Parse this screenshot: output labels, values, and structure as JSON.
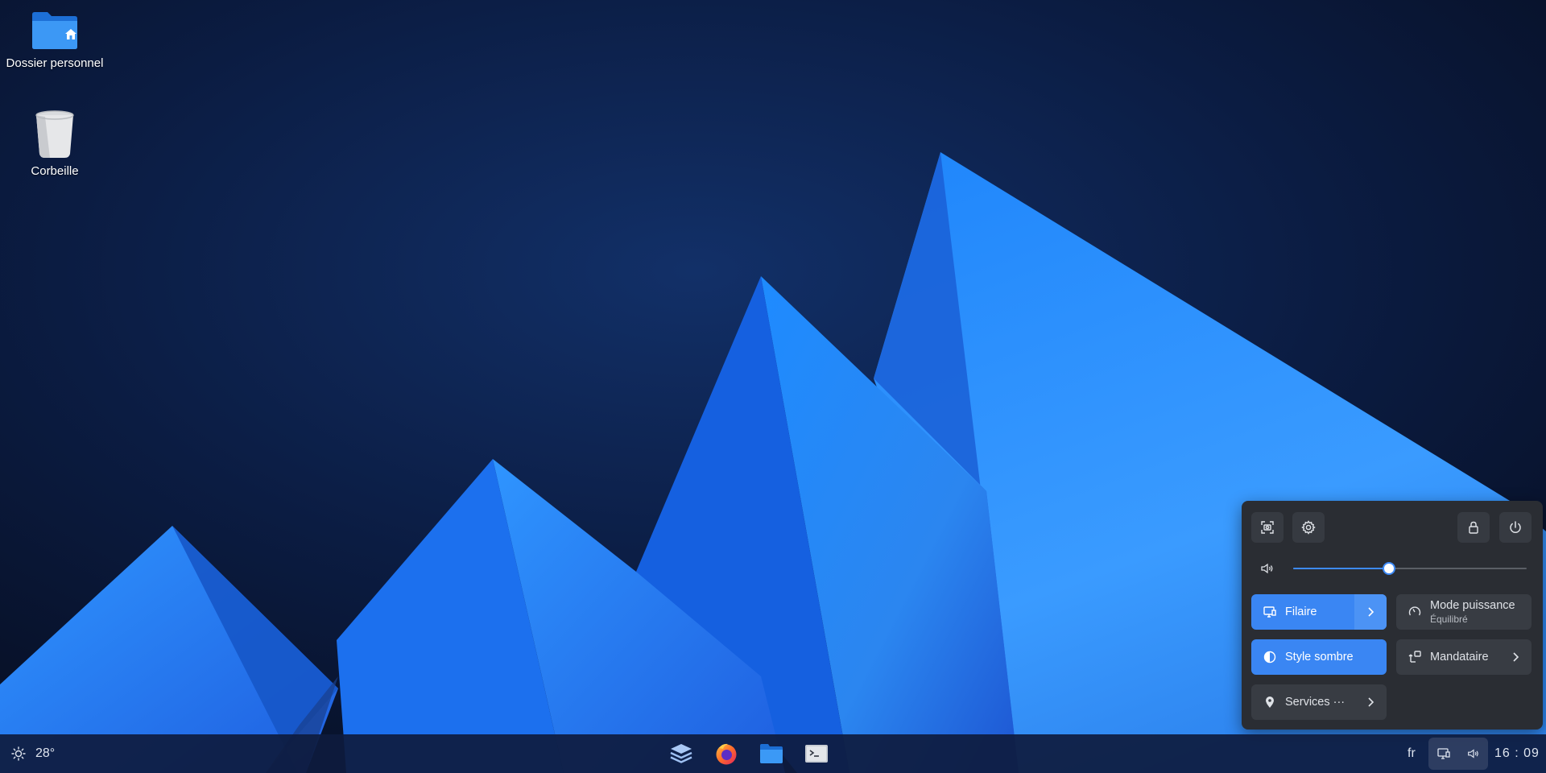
{
  "desktop": {
    "icons": [
      {
        "label": "Dossier personnel",
        "icon": "home-folder-icon"
      },
      {
        "label": "Corbeille",
        "icon": "trash-icon"
      }
    ]
  },
  "quick_settings": {
    "top_buttons": [
      {
        "icon": "screenshot-icon"
      },
      {
        "icon": "settings-gear-icon"
      },
      {
        "icon": "lock-icon"
      },
      {
        "icon": "power-icon"
      }
    ],
    "volume": {
      "icon": "volume-icon",
      "value_percent": 41
    },
    "tiles": {
      "wired": {
        "label": "Filaire",
        "icon": "wired-network-icon",
        "active": true
      },
      "power_mode": {
        "label": "Mode puissance",
        "sublabel": "Équilibré",
        "icon": "power-mode-icon",
        "active": false
      },
      "dark_style": {
        "label": "Style sombre",
        "icon": "dark-style-icon",
        "active": true
      },
      "proxy": {
        "label": "Mandataire",
        "icon": "proxy-icon",
        "active": false
      },
      "services": {
        "label": "Services ···",
        "icon": "location-icon",
        "active": false
      }
    },
    "colors": {
      "accent": "#3a86f3",
      "panel": "#2a2d33"
    }
  },
  "taskbar": {
    "weather": {
      "icon": "sun-icon",
      "temperature": "28°"
    },
    "dock": [
      {
        "icon": "app-launcher-icon"
      },
      {
        "icon": "firefox-icon"
      },
      {
        "icon": "file-manager-icon"
      },
      {
        "icon": "terminal-icon"
      }
    ],
    "language": "fr",
    "tray": [
      {
        "icon": "network-tray-icon"
      },
      {
        "icon": "volume-tray-icon"
      }
    ],
    "clock": "16 : 09"
  }
}
